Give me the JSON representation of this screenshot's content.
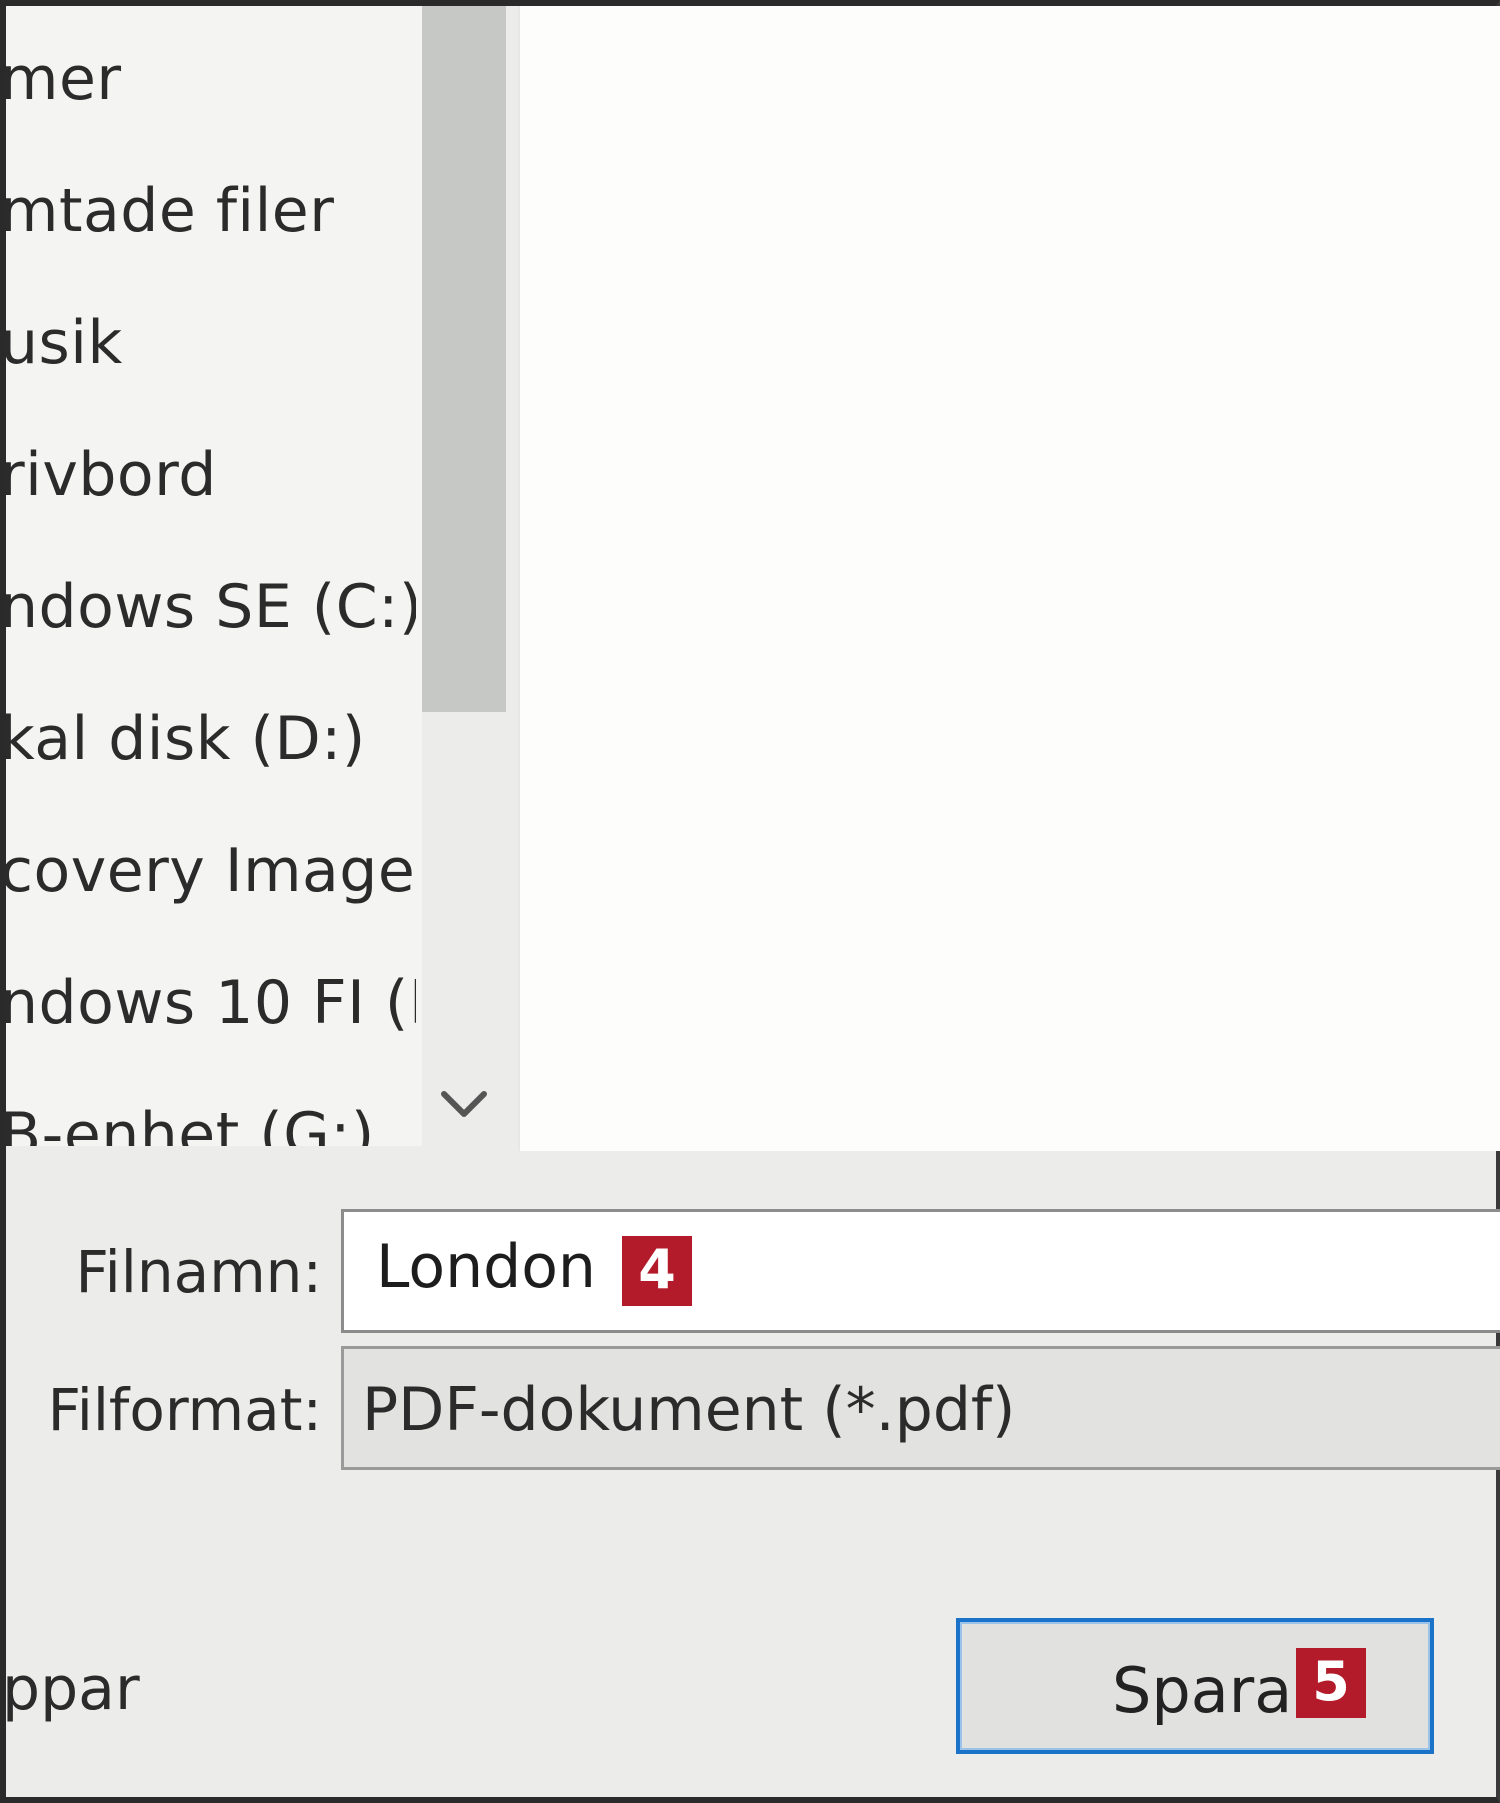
{
  "nav": {
    "items": [
      {
        "label": "mer"
      },
      {
        "label": "mtade filer"
      },
      {
        "label": "usik"
      },
      {
        "label": "rivbord"
      },
      {
        "label": "ndows SE (C:)"
      },
      {
        "label": "kal disk (D:)"
      },
      {
        "label": "covery Image"
      },
      {
        "label": "ndows 10 FI (F"
      },
      {
        "label": "B-enhet (G:)"
      }
    ]
  },
  "form": {
    "filename_label": "Filnamn:",
    "filename_value": "London",
    "filename_badge": "4",
    "format_label": "Filformat:",
    "format_value": "PDF-dokument (*.pdf)",
    "save_label": "Spara",
    "save_badge": "5",
    "footer_link": "ppar"
  },
  "icons": {
    "scroll_down": "chevron-down-icon"
  },
  "colors": {
    "badge": "#b31b2a",
    "button_border": "#1a73c8"
  }
}
